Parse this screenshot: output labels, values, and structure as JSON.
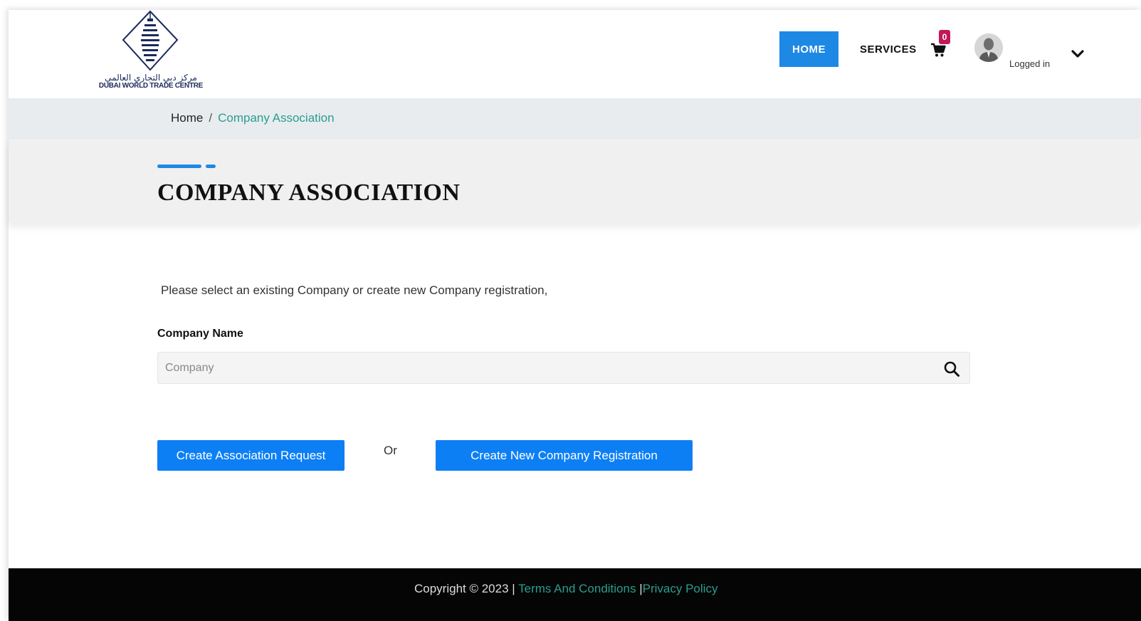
{
  "header": {
    "logo": {
      "arabic_text": "مركز دبي التجاري العالمي",
      "english_text": "DUBAI WORLD TRADE CENTRE",
      "icon": "tower-diamond-logo"
    },
    "nav": {
      "home_label": "HOME",
      "services_label": "SERVICES"
    },
    "cart": {
      "icon": "cart-icon",
      "count": "0"
    },
    "user": {
      "avatar_icon": "avatar-icon",
      "status": "Logged in",
      "menu_icon": "chevron-down-icon"
    }
  },
  "breadcrumb": {
    "home": "Home",
    "separator": "/",
    "current": "Company Association"
  },
  "page": {
    "title": "COMPANY ASSOCIATION",
    "accent_color": "#1e88e5"
  },
  "form": {
    "instructions": "Please select an existing Company or create new Company registration,",
    "company_label": "Company Name",
    "company_placeholder": "Company",
    "company_value": "",
    "search_icon": "search-icon"
  },
  "actions": {
    "association_button": "Create Association Request",
    "or_text": "Or",
    "new_company_button": "Create New Company Registration",
    "button_color": "#0d7ff5"
  },
  "footer": {
    "copyright": "Copyright © 2023 |",
    "terms": "Terms And Conditions",
    "separator": "|",
    "privacy": "Privacy Policy",
    "link_color": "#2a9d8f"
  }
}
